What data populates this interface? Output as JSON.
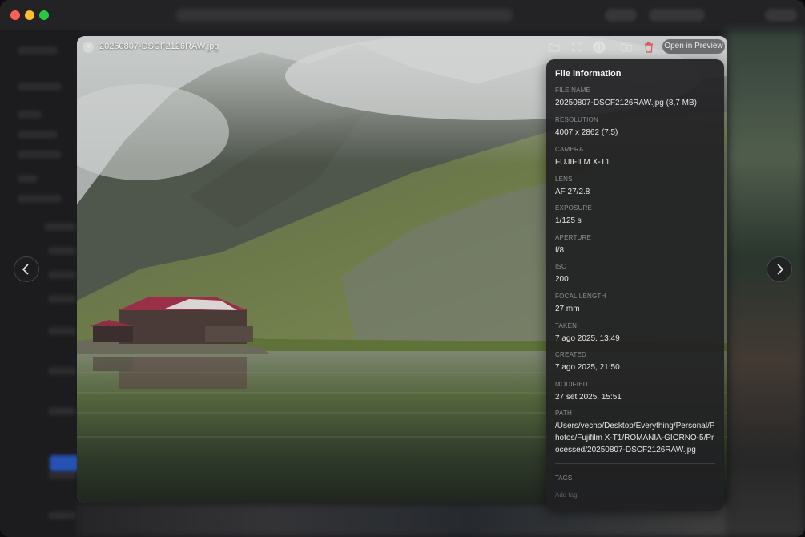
{
  "viewer": {
    "file_title": "20250807-DSCF2126RAW.jpg",
    "open_preview_label": "Open in Preview",
    "icons": [
      "folder-icon",
      "fullscreen-icon",
      "info-icon",
      "reveal-folder-icon",
      "trash-icon"
    ],
    "accent_delete": "#e05252"
  },
  "info": {
    "title": "File information",
    "fields": [
      {
        "label": "FILE NAME",
        "value": "20250807-DSCF2126RAW.jpg (8,7 MB)"
      },
      {
        "label": "RESOLUTION",
        "value": "4007 x 2862 (7:5)"
      },
      {
        "label": "CAMERA",
        "value": "FUJIFILM X-T1"
      },
      {
        "label": "LENS",
        "value": "AF 27/2.8"
      },
      {
        "label": "EXPOSURE",
        "value": "1/125 s"
      },
      {
        "label": "APERTURE",
        "value": "f/8"
      },
      {
        "label": "ISO",
        "value": "200"
      },
      {
        "label": "FOCAL LENGTH",
        "value": "27 mm"
      },
      {
        "label": "TAKEN",
        "value": "7 ago 2025, 13:49"
      },
      {
        "label": "CREATED",
        "value": "7 ago 2025, 21:50"
      },
      {
        "label": "MODIFIED",
        "value": "27 set 2025, 15:51"
      },
      {
        "label": "PATH",
        "value": "/Users/vecho/Desktop/Everything/Personal/Photos/Fujifilm X-T1/ROMANIA-GIORNO-5/Processed/20250807-DSCF2126RAW.jpg"
      }
    ],
    "tags_label": "TAGS",
    "tag_placeholder": "Add tag"
  },
  "navigation": {
    "prev_icon": "chevron-left-icon",
    "next_icon": "chevron-right-icon"
  }
}
